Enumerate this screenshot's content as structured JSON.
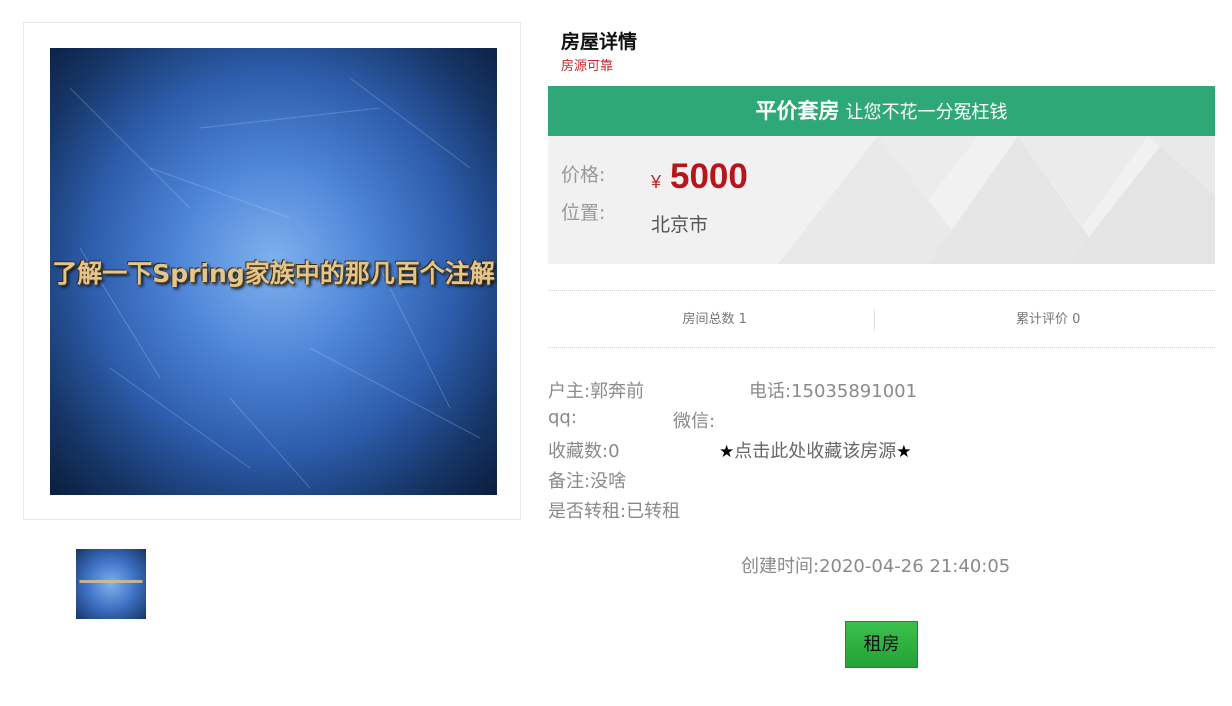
{
  "gallery": {
    "main_image_caption": "了解一下Spring家族中的那几百个注解",
    "thumbnail_alt": "了解一下Spring家族中的那几百个注解"
  },
  "header": {
    "title": "房屋详情",
    "subtitle": "房源可靠"
  },
  "banner": {
    "strong": "平价套房",
    "weak": "让您不花一分冤枉钱",
    "color": "#2fa877"
  },
  "price_box": {
    "price_label": "价格:",
    "location_label": "位置:",
    "currency": "¥",
    "price": "5000",
    "location": "北京市"
  },
  "stats": {
    "rooms": "房间总数 1",
    "reviews": "累计评价 0"
  },
  "owner": {
    "owner_label": "户主:",
    "owner_name": "郭奔前",
    "phone_label": "电话:",
    "phone": "15035891001",
    "qq_label": "qq:",
    "qq": "",
    "wechat_label": "微信:",
    "wechat": "",
    "favorites_label": "收藏数:",
    "favorites": "0",
    "favorite_action": "点击此处收藏该房源",
    "star_icon": "★",
    "remark_label": "备注:",
    "remark": "没啥",
    "sublet_label": "是否转租:",
    "sublet": "已转租"
  },
  "meta": {
    "created_label": "创建时间:",
    "created": "2020-04-26 21:40:05"
  },
  "actions": {
    "rent_button": "租房",
    "rent_button_color": "#2fa837"
  }
}
